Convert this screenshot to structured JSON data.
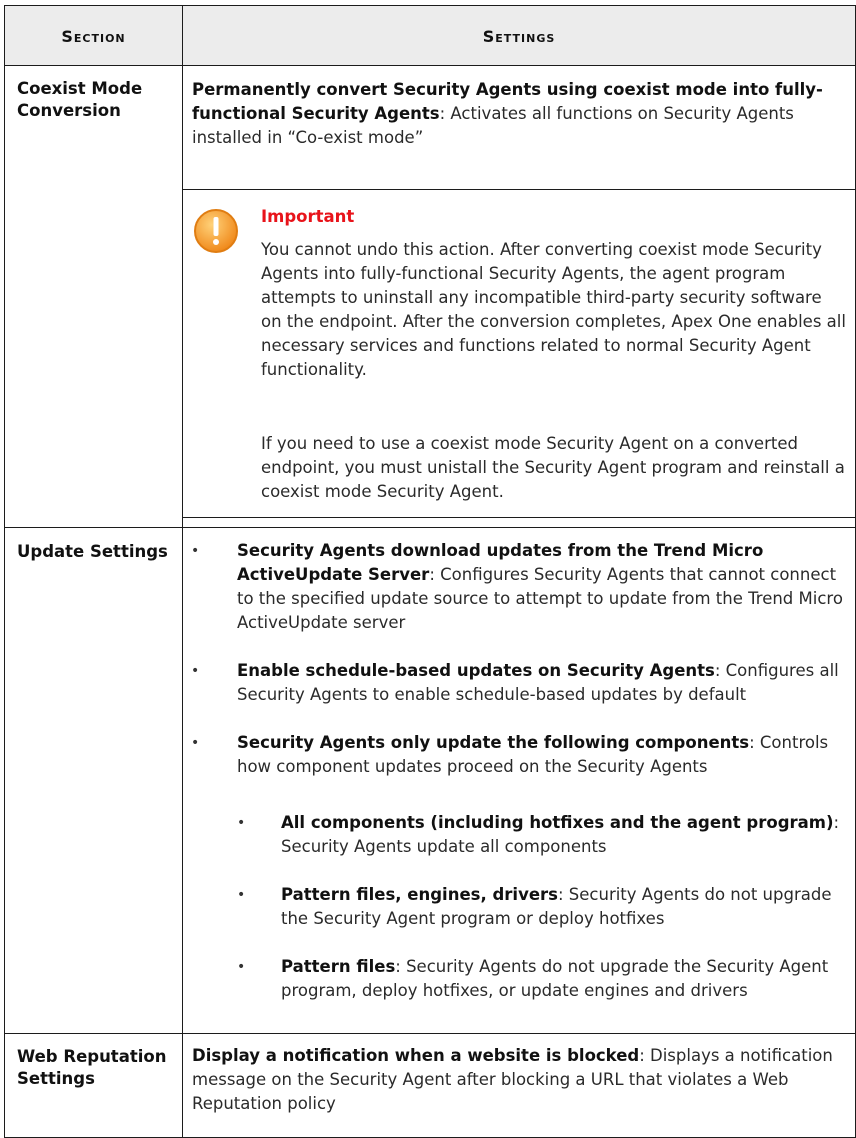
{
  "table": {
    "headers": {
      "section": "Section",
      "settings": "Settings"
    },
    "rows": [
      {
        "section": "Coexist Mode Conversion",
        "settings": {
          "bold": "Permanently convert Security Agents using coexist mode into fully-functional Security Agents",
          "text": ": Activates all functions on Security Agents installed in “Co-exist mode”"
        },
        "note": {
          "icon": "warning-icon",
          "icon_color": "#f4a12b",
          "title": "Important",
          "title_color": "#e8131a",
          "paragraphs": [
            "You cannot undo this action. After converting coexist mode Security Agents into fully-functional Security Agents, the agent program attempts to uninstall any incompatible third-party security software on the endpoint. After the conversion completes, Apex One enables all necessary services and functions related to normal Security Agent functionality.",
            "If you need to use a coexist mode Security Agent on a converted endpoint, you must unistall the Security Agent program and reinstall a coexist mode Security Agent."
          ]
        }
      },
      {
        "section": "Update Settings",
        "bullets": [
          {
            "bold": "Security Agents download updates from the Trend Micro ActiveUpdate Server",
            "text": ": Configures Security Agents that cannot connect to the specified update source to attempt to update from the Trend Micro ActiveUpdate server"
          },
          {
            "bold": "Enable schedule-based updates on Security Agents",
            "text": ": Configures all Security Agents to enable schedule-based updates by default"
          },
          {
            "bold": "Security Agents only update the following components",
            "text": ": Controls how component updates proceed on the Security Agents"
          }
        ],
        "sub_bullets": [
          {
            "bold": "All components (including hotfixes and the agent program)",
            "text": ": Security Agents update all components"
          },
          {
            "bold": "Pattern files, engines, drivers",
            "text": ": Security Agents do not upgrade the Security Agent program or deploy hotfixes"
          },
          {
            "bold": "Pattern files",
            "text": ": Security Agents do not upgrade the Security Agent program, deploy hotfixes, or update engines and drivers"
          }
        ]
      },
      {
        "section": "Web Reputation Settings",
        "settings": {
          "bold": "Display a notification when a website is blocked",
          "text": ": Displays a notification message on the Security Agent after blocking a URL that violates a Web Reputation policy"
        }
      }
    ],
    "bullet_glyph": "•"
  }
}
